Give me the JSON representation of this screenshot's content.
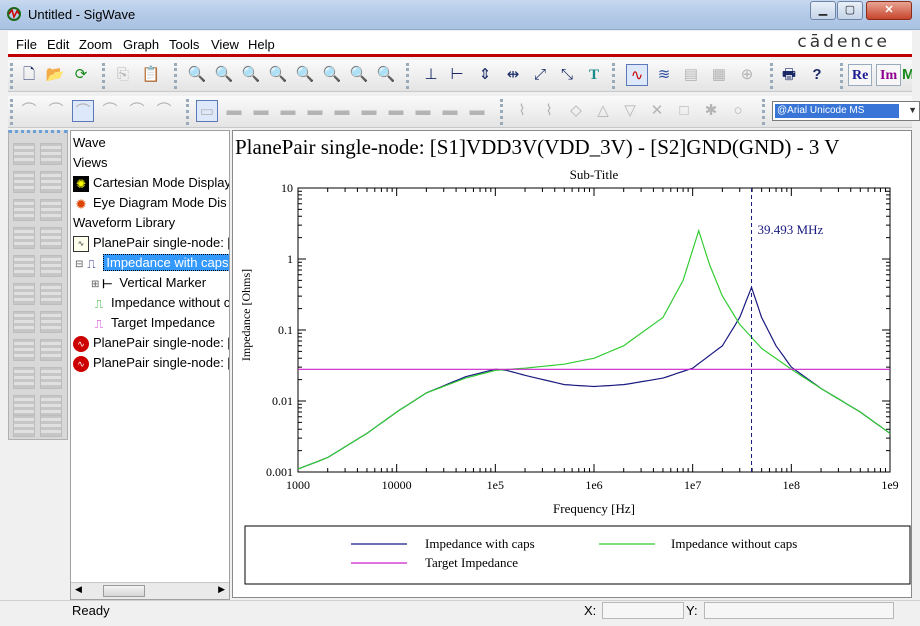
{
  "window": {
    "title": "Untitled - SigWave",
    "min_symbol": "▁",
    "max_symbol": "▢",
    "close_symbol": "✕"
  },
  "menu": {
    "items": [
      "File",
      "Edit",
      "Zoom",
      "Graph",
      "Tools",
      "View",
      "Help"
    ],
    "logo": "cādence"
  },
  "toolbar": {
    "re_label": "Re",
    "im_label": "Im",
    "font_value": "@Arial Unicode MS"
  },
  "tree": {
    "rows": [
      {
        "label": "Wave",
        "icon": ""
      },
      {
        "label": "Views",
        "icon": ""
      },
      {
        "label": "Cartesian Mode Display",
        "icon": "sun-icon"
      },
      {
        "label": "Eye Diagram Mode Dis",
        "icon": "eye-star-icon"
      },
      {
        "label": "Waveform Library",
        "icon": ""
      },
      {
        "label": "PlanePair single-node: [",
        "icon": "waveform-doc-icon"
      },
      {
        "label": "Impedance with caps",
        "icon": "wave-blue-icon"
      },
      {
        "label": "Vertical Marker",
        "icon": "marker-icon"
      },
      {
        "label": "Impedance without c",
        "icon": "wave-green-icon"
      },
      {
        "label": "Target Impedance",
        "icon": "wave-magenta-icon"
      },
      {
        "label": "PlanePair single-node: [",
        "icon": "waveform-red-icon"
      },
      {
        "label": "PlanePair single-node: [",
        "icon": "waveform-red-icon"
      }
    ]
  },
  "plot": {
    "title": "PlanePair single-node: [S1]VDD3V(VDD_3V) - [S2]GND(GND) - 3 V",
    "subtitle": "Sub-Title",
    "marker_label": "39.493 MHz",
    "legend": {
      "with_caps": "Impedance with caps",
      "without_caps": "Impedance without caps",
      "target": "Target Impedance"
    }
  },
  "chart_data": {
    "type": "line",
    "title": "PlanePair single-node: [S1]VDD3V(VDD_3V) - [S2]GND(GND) - 3 V",
    "subtitle": "Sub-Title",
    "xlabel": "Frequency [Hz]",
    "ylabel": "Impedance [Ohms]",
    "x_scale": "log",
    "y_scale": "log",
    "xlim": [
      1000,
      1000000000
    ],
    "ylim": [
      0.001,
      10
    ],
    "x_ticks": [
      "1000",
      "10000",
      "1e5",
      "1e6",
      "1e7",
      "1e8",
      "1e9"
    ],
    "y_ticks": [
      "10",
      "1",
      "0.1",
      "0.01",
      "0.001"
    ],
    "marker_x": 39493000,
    "marker_label": "39.493 MHz",
    "legend_position": "bottom",
    "series": [
      {
        "name": "Impedance with caps",
        "color": "#1a1a80",
        "points": [
          [
            1000,
            0.0011
          ],
          [
            2000,
            0.0016
          ],
          [
            5000,
            0.0035
          ],
          [
            10000,
            0.007
          ],
          [
            20000,
            0.013
          ],
          [
            50000,
            0.022
          ],
          [
            100000,
            0.028
          ],
          [
            130000,
            0.027
          ],
          [
            200000,
            0.023
          ],
          [
            500000,
            0.017
          ],
          [
            1000000,
            0.016
          ],
          [
            2000000,
            0.017
          ],
          [
            5000000,
            0.021
          ],
          [
            10000000,
            0.029
          ],
          [
            20000000,
            0.06
          ],
          [
            30000000,
            0.15
          ],
          [
            39493000,
            0.4
          ],
          [
            50000000,
            0.15
          ],
          [
            70000000,
            0.06
          ],
          [
            100000000,
            0.03
          ],
          [
            200000000,
            0.015
          ],
          [
            500000000,
            0.007
          ],
          [
            1000000000,
            0.0035
          ]
        ]
      },
      {
        "name": "Impedance without caps",
        "color": "#33cc33",
        "points": [
          [
            1000,
            0.0011
          ],
          [
            2000,
            0.0016
          ],
          [
            5000,
            0.0035
          ],
          [
            10000,
            0.007
          ],
          [
            20000,
            0.013
          ],
          [
            50000,
            0.021
          ],
          [
            100000,
            0.027
          ],
          [
            200000,
            0.029
          ],
          [
            500000,
            0.033
          ],
          [
            1000000,
            0.04
          ],
          [
            2000000,
            0.06
          ],
          [
            5000000,
            0.15
          ],
          [
            8000000,
            0.5
          ],
          [
            11500000,
            2.5
          ],
          [
            15000000,
            0.8
          ],
          [
            20000000,
            0.3
          ],
          [
            30000000,
            0.12
          ],
          [
            50000000,
            0.055
          ],
          [
            100000000,
            0.028
          ],
          [
            200000000,
            0.015
          ],
          [
            500000000,
            0.007
          ],
          [
            1000000000,
            0.0035
          ]
        ]
      },
      {
        "name": "Target Impedance",
        "color": "#cc22cc",
        "points": [
          [
            1000,
            0.028
          ],
          [
            1000000000,
            0.028
          ]
        ]
      }
    ]
  },
  "status": {
    "text": "Ready",
    "x_label": "X:",
    "y_label": "Y:"
  }
}
